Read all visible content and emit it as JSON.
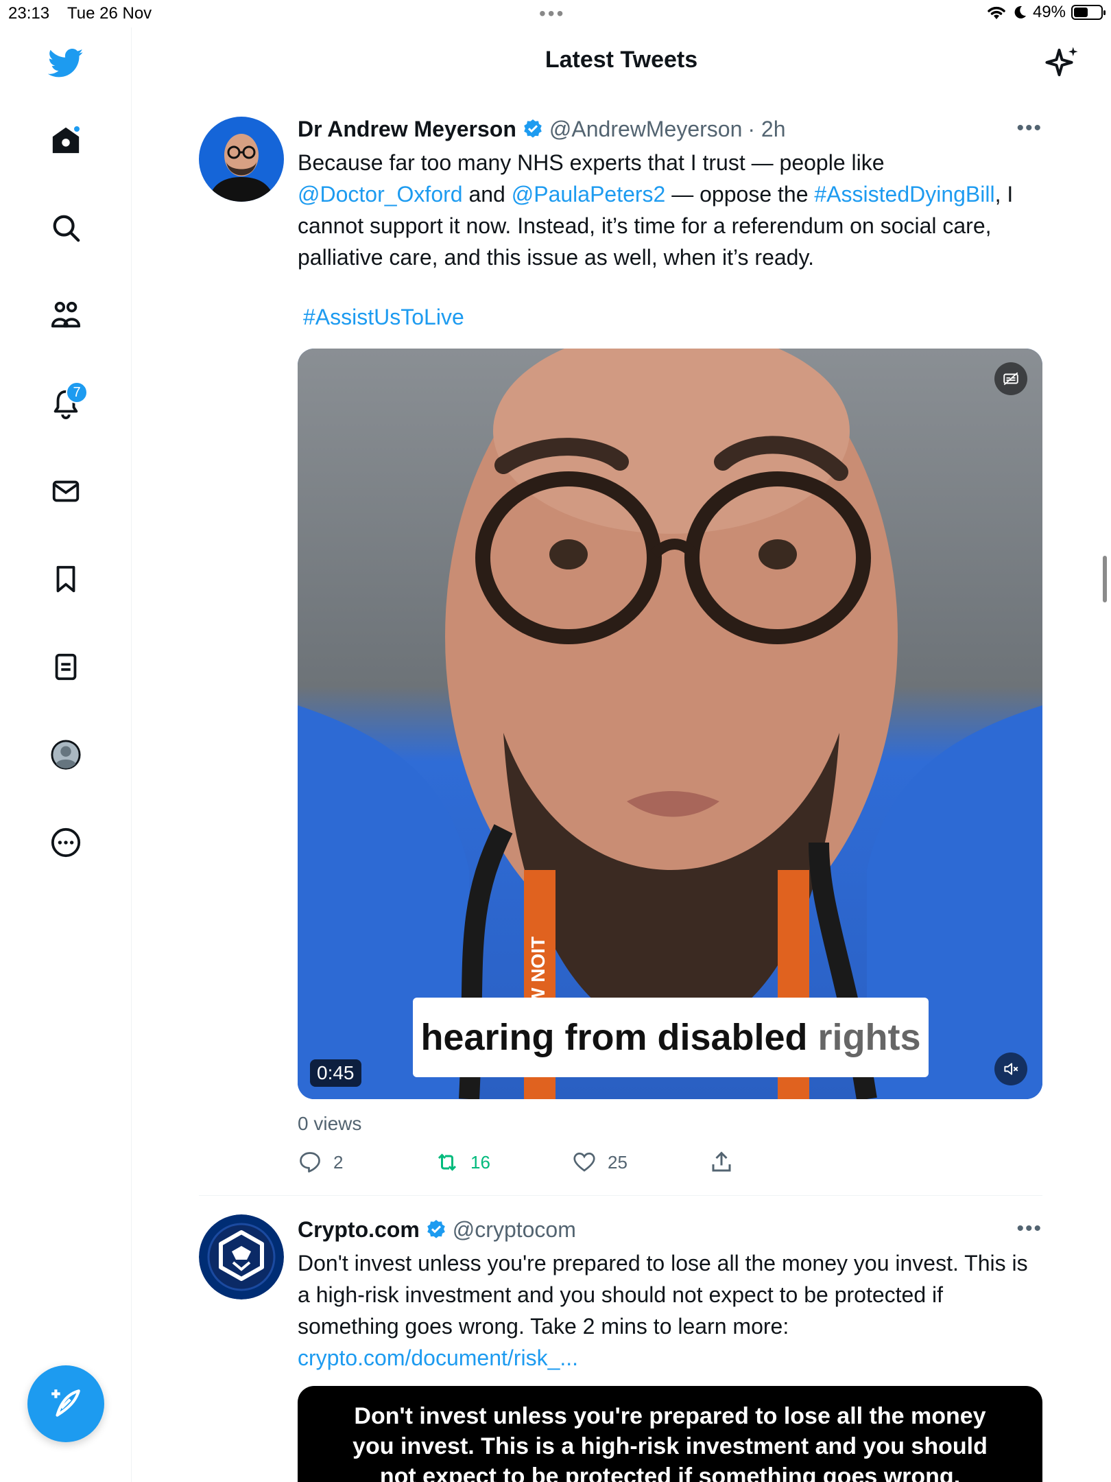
{
  "status_bar": {
    "time": "23:13",
    "date": "Tue 26 Nov",
    "battery": "49%",
    "battery_level": 0.49
  },
  "header": {
    "title": "Latest Tweets"
  },
  "sidebar": {
    "items": [
      {
        "name": "home-icon",
        "has_dot": true
      },
      {
        "name": "search-icon"
      },
      {
        "name": "communities-icon"
      },
      {
        "name": "notifications-icon",
        "badge": "7"
      },
      {
        "name": "messages-icon"
      },
      {
        "name": "bookmarks-icon"
      },
      {
        "name": "lists-icon"
      },
      {
        "name": "profile-icon"
      },
      {
        "name": "more-icon"
      }
    ],
    "compose": "compose-icon"
  },
  "tweets": [
    {
      "name": "Dr Andrew Meyerson",
      "handle": "@AndrewMeyerson",
      "time": "· 2h",
      "text_1": "Because far too many NHS experts that I trust — people like",
      "mention_1": "@Doctor_Oxford",
      "and": " and ",
      "mention_2": "@PaulaPeters2",
      "text_2": " — oppose the ",
      "hashtag_1": "#AssistedDyingBill",
      "text_3": ", I cannot support it now. Instead, it’s time for a referendum on social care, palliative care, and this issue as well, when it’s ready.",
      "hashtag_2": "#AssistUsToLive",
      "video": {
        "duration": "0:45",
        "caption_main": "hearing from disabled ",
        "caption_dim": "rights",
        "lanyard": "NOW NOIT"
      },
      "views": "0 views",
      "replies": "2",
      "retweets": "16",
      "likes": "25"
    },
    {
      "name": "Crypto.com",
      "handle": "@cryptocom",
      "text": "Don't invest unless you're prepared to lose all the money you invest. This is a high-risk investment and you should not expect to be protected if something goes wrong. Take 2 mins to learn more:",
      "link": "crypto.com/document/risk_...",
      "media_line_1": "Don't invest unless you're prepared to lose all the money",
      "media_line_2": "you invest. This is a high-risk investment and you should",
      "media_line_3": "not expect to be protected if something goes wrong."
    }
  ],
  "colors": {
    "accent": "#1d9bf0",
    "retweet_green": "#00ba7c",
    "secondary_text": "#536471"
  }
}
